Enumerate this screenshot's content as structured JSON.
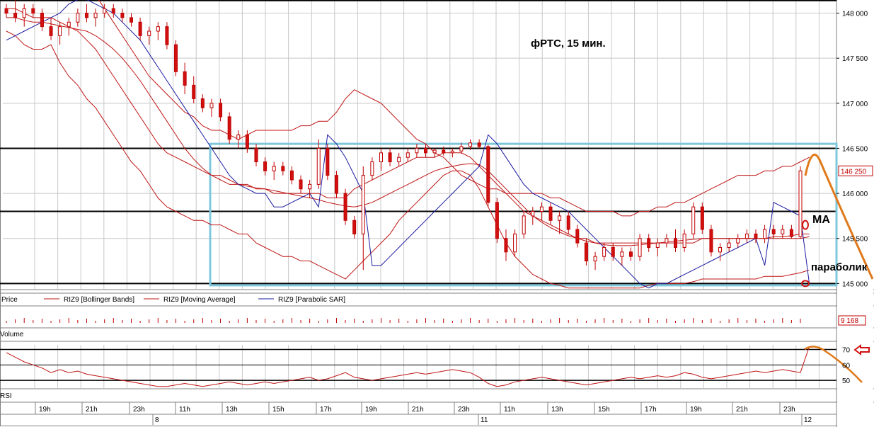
{
  "chart_data": {
    "type": "candlestick",
    "annotation_title": "фРТС,  15 мин.",
    "price_axis": {
      "ticks": [
        145000,
        145500,
        146000,
        146500,
        147000,
        147500,
        148000
      ],
      "tick_labels": [
        "145 000",
        "145 500",
        "146 000",
        "146 500",
        "147 000",
        "147 500",
        "148 000"
      ],
      "ylim": [
        144940,
        148130
      ],
      "current_price_label": "146 250"
    },
    "legend": {
      "price": "Price",
      "bollinger": "RIZ9 [Bollinger Bands]",
      "moving_average": "RIZ9 [Moving Average]",
      "parabolic_sar": "RIZ9 [Parabolic SAR]"
    },
    "volume_panel": {
      "label": "Volume",
      "last_value_label": "9 168"
    },
    "rsi_panel": {
      "label": "RSI",
      "ticks": [
        50,
        60,
        70
      ],
      "tick_labels": [
        "50",
        "60",
        "70"
      ],
      "ylim": [
        45,
        73
      ]
    },
    "time_axis": {
      "hour_labels": [
        "19h",
        "21h",
        "23h",
        "11h",
        "13h",
        "15h",
        "17h",
        "19h",
        "21h",
        "23h",
        "11h",
        "13h",
        "15h",
        "17h",
        "19h",
        "21h",
        "23h"
      ],
      "day_labels": [
        "8",
        "11",
        "12"
      ]
    },
    "horizontal_levels": [
      148140,
      146500,
      145800,
      145000
    ],
    "box": {
      "price_top": 146550,
      "price_bottom": 144980
    },
    "candles": [
      [
        148050,
        148100,
        147950,
        148000
      ],
      [
        148000,
        148150,
        147900,
        147950
      ],
      [
        147950,
        148100,
        147850,
        148050
      ],
      [
        148050,
        148100,
        147950,
        148000
      ],
      [
        148000,
        148050,
        147800,
        147850
      ],
      [
        147850,
        147950,
        147700,
        147750
      ],
      [
        147750,
        147900,
        147650,
        147850
      ],
      [
        147850,
        147950,
        147750,
        147900
      ],
      [
        147900,
        148050,
        147850,
        148000
      ],
      [
        148000,
        148100,
        147900,
        147950
      ],
      [
        147950,
        148050,
        147850,
        148000
      ],
      [
        148000,
        148100,
        147950,
        148050
      ],
      [
        148050,
        148100,
        147950,
        148000
      ],
      [
        148000,
        148050,
        147900,
        147950
      ],
      [
        147950,
        148000,
        147850,
        147900
      ],
      [
        147900,
        147950,
        147700,
        147750
      ],
      [
        147750,
        147850,
        147650,
        147800
      ],
      [
        147800,
        147900,
        147700,
        147850
      ],
      [
        147850,
        147900,
        147600,
        147650
      ],
      [
        147650,
        147700,
        147300,
        147350
      ],
      [
        147350,
        147450,
        147100,
        147200
      ],
      [
        147200,
        147300,
        147000,
        147050
      ],
      [
        147050,
        147100,
        146900,
        146950
      ],
      [
        146950,
        147050,
        146850,
        147000
      ],
      [
        147000,
        147050,
        146800,
        146850
      ],
      [
        146850,
        146900,
        146550,
        146600
      ],
      [
        146600,
        146700,
        146500,
        146650
      ],
      [
        146650,
        146700,
        146450,
        146500
      ],
      [
        146500,
        146550,
        146300,
        146350
      ],
      [
        146350,
        146400,
        146200,
        146250
      ],
      [
        146250,
        146350,
        146150,
        146300
      ],
      [
        146300,
        146350,
        146200,
        146250
      ],
      [
        146250,
        146300,
        146100,
        146150
      ],
      [
        146150,
        146200,
        146000,
        146050
      ],
      [
        146050,
        146150,
        145950,
        146100
      ],
      [
        146100,
        146600,
        146050,
        146500
      ],
      [
        146500,
        146550,
        146150,
        146200
      ],
      [
        146200,
        146250,
        145950,
        146000
      ],
      [
        146000,
        146050,
        145650,
        145700
      ],
      [
        145700,
        145750,
        145500,
        145550
      ],
      [
        145550,
        146300,
        145150,
        146200
      ],
      [
        146200,
        146400,
        146150,
        146350
      ],
      [
        146350,
        146500,
        146250,
        146450
      ],
      [
        146450,
        146500,
        146300,
        146350
      ],
      [
        146350,
        146450,
        146300,
        146400
      ],
      [
        146400,
        146500,
        146350,
        146450
      ],
      [
        146450,
        146550,
        146400,
        146500
      ],
      [
        146500,
        146550,
        146400,
        146450
      ],
      [
        146450,
        146500,
        146400,
        146480
      ],
      [
        146480,
        146520,
        146420,
        146450
      ],
      [
        146450,
        146500,
        146400,
        146470
      ],
      [
        146470,
        146560,
        146440,
        146520
      ],
      [
        146520,
        146600,
        146480,
        146560
      ],
      [
        146560,
        146600,
        146500,
        146520
      ],
      [
        146520,
        146540,
        145850,
        145900
      ],
      [
        145900,
        145950,
        145450,
        145500
      ],
      [
        145500,
        145600,
        145250,
        145350
      ],
      [
        145350,
        145600,
        145300,
        145550
      ],
      [
        145550,
        145800,
        145500,
        145750
      ],
      [
        145750,
        145850,
        145650,
        145800
      ],
      [
        145800,
        145900,
        145700,
        145850
      ],
      [
        145850,
        145900,
        145650,
        145700
      ],
      [
        145700,
        145800,
        145550,
        145750
      ],
      [
        145750,
        145800,
        145550,
        145600
      ],
      [
        145600,
        145650,
        145400,
        145450
      ],
      [
        145450,
        145500,
        145200,
        145250
      ],
      [
        145250,
        145350,
        145150,
        145300
      ],
      [
        145300,
        145450,
        145250,
        145400
      ],
      [
        145400,
        145450,
        145250,
        145300
      ],
      [
        145300,
        145400,
        145200,
        145350
      ],
      [
        145350,
        145400,
        145250,
        145300
      ],
      [
        145300,
        145550,
        145250,
        145500
      ],
      [
        145500,
        145550,
        145350,
        145400
      ],
      [
        145400,
        145500,
        145300,
        145450
      ],
      [
        145450,
        145550,
        145400,
        145500
      ],
      [
        145500,
        145600,
        145350,
        145400
      ],
      [
        145400,
        145600,
        145350,
        145550
      ],
      [
        145550,
        145900,
        145500,
        145850
      ],
      [
        145850,
        145900,
        145550,
        145600
      ],
      [
        145600,
        145650,
        145300,
        145350
      ],
      [
        145350,
        145450,
        145250,
        145400
      ],
      [
        145400,
        145500,
        145350,
        145450
      ],
      [
        145450,
        145550,
        145400,
        145500
      ],
      [
        145500,
        145600,
        145450,
        145550
      ],
      [
        145550,
        145600,
        145450,
        145500
      ],
      [
        145500,
        145650,
        145450,
        145600
      ],
      [
        145600,
        145650,
        145500,
        145550
      ],
      [
        145550,
        145650,
        145500,
        145600
      ],
      [
        145600,
        145650,
        145500,
        145520
      ],
      [
        145520,
        146300,
        145500,
        146250
      ]
    ],
    "bollinger_upper": [
      148300,
      148350,
      148350,
      148300,
      148250,
      148250,
      148350,
      148400,
      148400,
      148300,
      148200,
      148050,
      147900,
      147750,
      147600,
      147450,
      147300,
      147200,
      147100,
      147000,
      146900,
      146850,
      146750,
      146700,
      146700,
      146650,
      146600,
      146650,
      146700,
      146700,
      146700,
      146700,
      146700,
      146750,
      146750,
      146800,
      146800,
      146900,
      147050,
      147150,
      147100,
      147050,
      147000,
      146900,
      146800,
      146700,
      146600,
      146550,
      146450,
      146400,
      146300,
      146200,
      146150,
      146100,
      146050,
      146050,
      146000,
      146000,
      146000,
      146000,
      146000,
      145950,
      145950,
      145900,
      145850,
      145800,
      145800,
      145800,
      145800,
      145750,
      145750,
      145800,
      145800,
      145850,
      145850,
      145900,
      145900,
      145950,
      146000,
      146050,
      146100,
      146150,
      146200,
      146200,
      146200,
      146250,
      146250,
      146300,
      146300,
      146350,
      146400
    ],
    "bollinger_middle": [
      148050,
      148050,
      148000,
      147950,
      147950,
      147950,
      147900,
      147850,
      147800,
      147700,
      147600,
      147450,
      147300,
      147150,
      147000,
      146850,
      146700,
      146550,
      146450,
      146400,
      146350,
      146300,
      146250,
      146200,
      146200,
      146150,
      146100,
      146100,
      146050,
      146050,
      146000,
      146000,
      146000,
      146000,
      146000,
      146000,
      145950,
      145950,
      145950,
      146050,
      146100,
      146150,
      146200,
      146250,
      146300,
      146350,
      146400,
      146400,
      146400,
      146450,
      146450,
      146450,
      146400,
      146300,
      146200,
      146100,
      146000,
      145900,
      145800,
      145750,
      145700,
      145650,
      145600,
      145550,
      145500,
      145500,
      145450,
      145450,
      145450,
      145450,
      145450,
      145450,
      145450,
      145450,
      145450,
      145450,
      145450,
      145450,
      145500,
      145500,
      145500,
      145500,
      145500,
      145500,
      145500,
      145500,
      145520,
      145520,
      145530,
      145550,
      145550
    ],
    "bollinger_lower": [
      147800,
      147750,
      147650,
      147600,
      147600,
      147650,
      147450,
      147300,
      147200,
      147050,
      146950,
      146800,
      146650,
      146500,
      146350,
      146250,
      146100,
      145950,
      145850,
      145800,
      145750,
      145700,
      145700,
      145650,
      145650,
      145600,
      145550,
      145550,
      145450,
      145400,
      145350,
      145300,
      145300,
      145250,
      145250,
      145200,
      145150,
      145100,
      145050,
      145150,
      145250,
      145350,
      145450,
      145550,
      145700,
      145800,
      145900,
      146000,
      146100,
      146200,
      146250,
      146250,
      146200,
      146050,
      145850,
      145650,
      145450,
      145300,
      145200,
      145100,
      145050,
      145000,
      144980,
      144950,
      144950,
      144950,
      144950,
      144950,
      144950,
      144950,
      144950,
      144950,
      144980,
      145000,
      145000,
      145000,
      145000,
      145020,
      145050,
      145050,
      145050,
      145050,
      145050,
      145050,
      145050,
      145080,
      145080,
      145080,
      145100,
      145120,
      145150
    ],
    "moving_average": [
      147950,
      147950,
      147920,
      147900,
      147900,
      147880,
      147860,
      147840,
      147820,
      147800,
      147750,
      147680,
      147600,
      147500,
      147380,
      147250,
      147100,
      146950,
      146800,
      146650,
      146500,
      146380,
      146280,
      146200,
      146150,
      146100,
      146100,
      146080,
      146060,
      146050,
      146030,
      146010,
      145990,
      145970,
      145950,
      145930,
      145900,
      145880,
      145860,
      145850,
      145870,
      145900,
      145950,
      146000,
      146050,
      146100,
      146150,
      146200,
      146250,
      146280,
      146300,
      146320,
      146330,
      146320,
      146250,
      146150,
      146050,
      145950,
      145850,
      145750,
      145680,
      145620,
      145570,
      145530,
      145500,
      145470,
      145450,
      145430,
      145420,
      145420,
      145420,
      145430,
      145440,
      145450,
      145460,
      145470,
      145480,
      145490,
      145500,
      145500,
      145500,
      145500,
      145500,
      145500,
      145500,
      145500,
      145500,
      145500,
      145500,
      145500,
      145520
    ],
    "parabolic_sar": [
      147700,
      147750,
      147800,
      147850,
      147900,
      147950,
      148000,
      148100,
      148150,
      148150,
      148100,
      148050,
      148000,
      147900,
      147800,
      147700,
      147550,
      147400,
      147250,
      147100,
      146950,
      146800,
      146650,
      146500,
      146350,
      146200,
      146100,
      146050,
      146000,
      146000,
      145850,
      145850,
      145900,
      145950,
      146000,
      145850,
      146650,
      146550,
      146400,
      146200,
      146000,
      145200,
      145200,
      145300,
      145400,
      145500,
      145600,
      145700,
      145800,
      145900,
      146000,
      146100,
      146200,
      146300,
      146650,
      146550,
      146400,
      146250,
      146100,
      146000,
      145950,
      145900,
      145850,
      145800,
      145700,
      145600,
      145500,
      145400,
      145300,
      145200,
      145100,
      145000,
      144950,
      145000,
      145000,
      145050,
      145100,
      145150,
      145200,
      145250,
      145300,
      145350,
      145400,
      145450,
      145500,
      145200,
      145900,
      145850,
      145800,
      145750,
      145000
    ],
    "rsi": [
      68,
      65,
      62,
      60,
      58,
      55,
      57,
      55,
      56,
      54,
      53,
      52,
      51,
      50,
      49,
      48,
      47,
      46,
      46,
      47,
      48,
      47,
      46,
      47,
      48,
      49,
      48,
      47,
      48,
      49,
      48,
      49,
      50,
      51,
      52,
      50,
      51,
      53,
      55,
      52,
      51,
      50,
      51,
      52,
      53,
      54,
      55,
      54,
      55,
      56,
      57,
      56,
      55,
      52,
      48,
      46,
      47,
      49,
      50,
      51,
      52,
      51,
      50,
      49,
      48,
      47,
      48,
      49,
      50,
      51,
      52,
      51,
      52,
      53,
      52,
      53,
      55,
      54,
      52,
      51,
      52,
      53,
      54,
      55,
      56,
      55,
      56,
      57,
      56,
      55,
      72
    ]
  },
  "annotations": {
    "ma_label": "MA",
    "sar_label": "параболик"
  },
  "colors": {
    "up_candle": "#ffffff",
    "down_candle": "#d11010",
    "candle_outline": "#c00000",
    "bollinger": "#c01515",
    "moving_average": "#c01515",
    "parabolic_sar": "#1a1aa0",
    "box": "#7fc8dc",
    "forecast_arrow": "#e0791a",
    "grid": "#c8c8c8",
    "level_line": "#000000"
  }
}
